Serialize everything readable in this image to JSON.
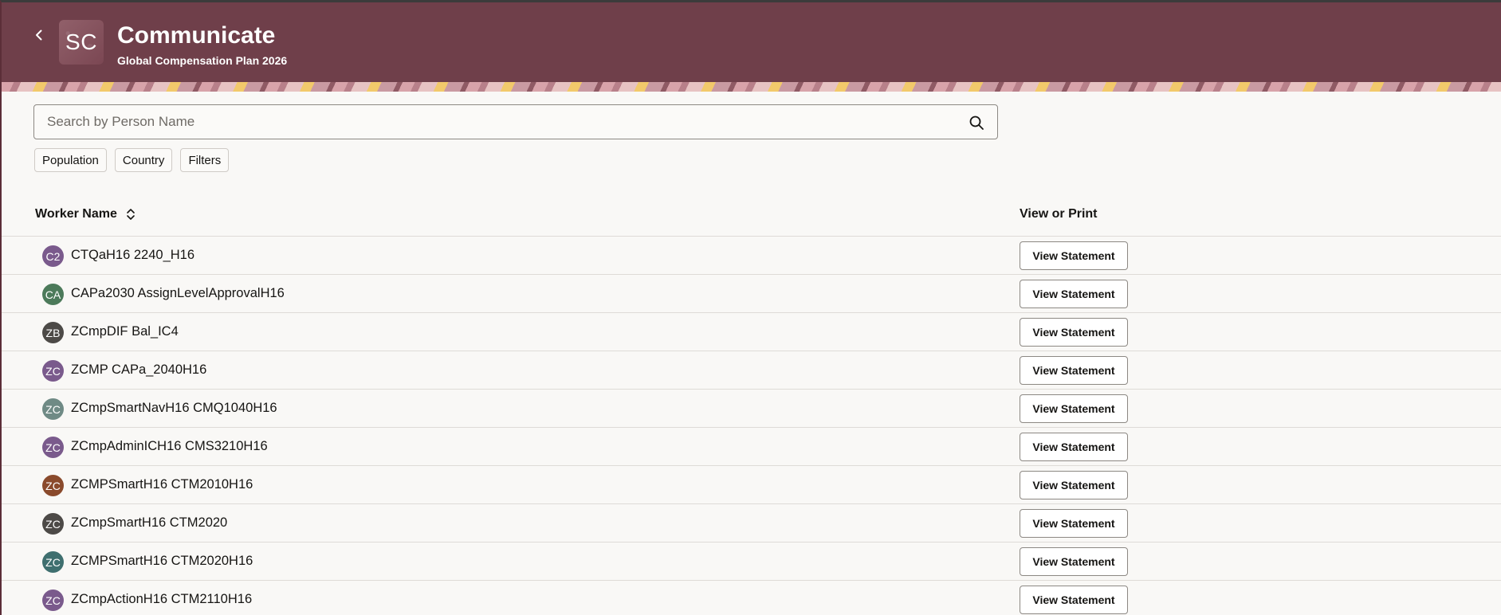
{
  "header": {
    "back_label": "Back",
    "badge_initials": "SC",
    "title": "Communicate",
    "subtitle": "Global Compensation Plan 2026",
    "background_color": "#6f3f4a"
  },
  "search": {
    "placeholder": "Search by Person Name",
    "value": "",
    "icon": "search-icon"
  },
  "filters": [
    {
      "label": "Population"
    },
    {
      "label": "Country"
    },
    {
      "label": "Filters"
    }
  ],
  "table": {
    "columns": {
      "worker_name": "Worker Name",
      "view_or_print": "View or Print"
    },
    "rows": [
      {
        "initials": "C2",
        "name": "CTQaH16 2240_H16",
        "avatar_color": "#7a5a8c",
        "action": "View Statement"
      },
      {
        "initials": "CA",
        "name": "CAPa2030 AssignLevelApprovalH16",
        "avatar_color": "#4c7a5a",
        "action": "View Statement"
      },
      {
        "initials": "ZB",
        "name": "ZCmpDIF Bal_IC4",
        "avatar_color": "#4d4a47",
        "action": "View Statement"
      },
      {
        "initials": "ZC",
        "name": "ZCMP CAPa_2040H16",
        "avatar_color": "#7a5a8c",
        "action": "View Statement"
      },
      {
        "initials": "ZC",
        "name": "ZCmpSmartNavH16 CMQ1040H16",
        "avatar_color": "#6f8a85",
        "action": "View Statement"
      },
      {
        "initials": "ZC",
        "name": "ZCmpAdminICH16 CMS3210H16",
        "avatar_color": "#7a5a8c",
        "action": "View Statement"
      },
      {
        "initials": "ZC",
        "name": "ZCMPSmartH16 CTM2010H16",
        "avatar_color": "#8a4a2c",
        "action": "View Statement"
      },
      {
        "initials": "ZC",
        "name": "ZCmpSmartH16 CTM2020",
        "avatar_color": "#4d4a47",
        "action": "View Statement"
      },
      {
        "initials": "ZC",
        "name": "ZCMPSmartH16 CTM2020H16",
        "avatar_color": "#3f6f6f",
        "action": "View Statement"
      },
      {
        "initials": "ZC",
        "name": "ZCmpActionH16 CTM2110H16",
        "avatar_color": "#7a5a8c",
        "action": "View Statement"
      }
    ]
  }
}
